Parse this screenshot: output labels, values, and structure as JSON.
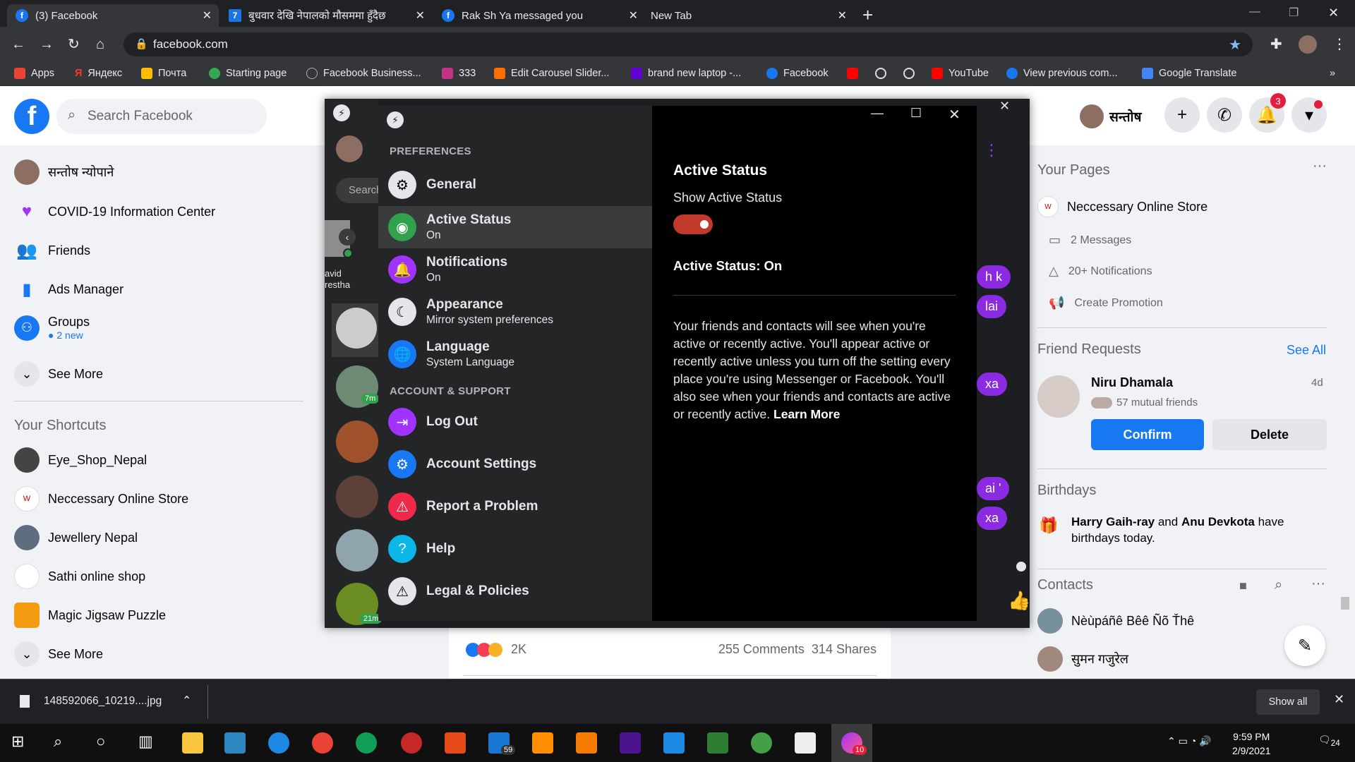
{
  "browser": {
    "tabs": [
      {
        "title": "(3) Facebook",
        "active": true
      },
      {
        "title": "बुधवार देखि नेपालको मौसममा हुँदैछ",
        "active": false
      },
      {
        "title": "Rak Sh Ya messaged you",
        "active": false
      },
      {
        "title": "New Tab",
        "active": false
      }
    ],
    "url": "facebook.com",
    "bookmarks": [
      "Apps",
      "Яндекс",
      "Почта",
      "Starting page",
      "Facebook Business...",
      "333",
      "Edit Carousel Slider...",
      "brand new laptop -...",
      "Facebook",
      "YouTube",
      "View previous com...",
      "Google Translate"
    ]
  },
  "fb": {
    "search_placeholder": "Search Facebook",
    "profile_name": "सन्तोष",
    "notif_count": "3",
    "left_items": [
      {
        "label": "सन्तोष न्योपाने"
      },
      {
        "label": "COVID-19 Information Center"
      },
      {
        "label": "Friends"
      },
      {
        "label": "Ads Manager"
      },
      {
        "label": "Groups",
        "sub": "2 new"
      },
      {
        "label": "See More"
      }
    ],
    "shortcuts_title": "Your Shortcuts",
    "shortcuts": [
      "Eye_Shop_Nepal",
      "Neccessary Online Store",
      "Jewellery Nepal",
      "Sathi online shop",
      "Magic Jigsaw Puzzle",
      "See More"
    ],
    "right": {
      "your_pages_title": "Your Pages",
      "page_name": "Neccessary Online Store",
      "page_links": [
        "2 Messages",
        "20+ Notifications",
        "Create Promotion"
      ],
      "friend_requests_title": "Friend Requests",
      "see_all": "See All",
      "request_name": "Niru Dhamala",
      "request_age": "4d",
      "mutual": "57 mutual friends",
      "confirm": "Confirm",
      "delete": "Delete",
      "birthdays_title": "Birthdays",
      "birthday_a": "Harry Gaih-ray",
      "birthday_and": " and ",
      "birthday_b": "Anu Devkota",
      "birthday_rest": " have birthdays today.",
      "contacts_title": "Contacts",
      "contacts": [
        "Nèùpáñê Bêê Ñõ Ťhê",
        "सुमन गजुरेल"
      ]
    },
    "post_stats": {
      "reactions": "2K",
      "comments": "255 Comments",
      "shares": "314 Shares"
    }
  },
  "messenger": {
    "search_placeholder": "Search",
    "contact_names": [
      "avid",
      "restha"
    ],
    "badges": [
      "7m",
      "21m"
    ],
    "bubbles": [
      "h k",
      "lai",
      "xa",
      "ai '",
      "xa"
    ],
    "preferences_header": "PREFERENCES",
    "preferences": [
      {
        "title": "General",
        "sub": ""
      },
      {
        "title": "Active Status",
        "sub": "On"
      },
      {
        "title": "Notifications",
        "sub": "On"
      },
      {
        "title": "Appearance",
        "sub": "Mirror system preferences"
      },
      {
        "title": "Language",
        "sub": "System Language"
      }
    ],
    "account_header": "ACCOUNT & SUPPORT",
    "account": [
      "Log Out",
      "Account Settings",
      "Report a Problem",
      "Help",
      "Legal & Policies"
    ],
    "detail": {
      "title": "Active Status",
      "toggle_label": "Show Active Status",
      "toggle_on": true,
      "status_line": "Active Status: On",
      "description": "Your friends and contacts will see when you're active or recently active. You'll appear active or recently active unless you turn off the setting every place you're using Messenger or Facebook. You'll also see when your friends and contacts are active or recently active.",
      "learn_more": "Learn More"
    },
    "accent_color": "#e1306c"
  },
  "downloads": {
    "file": "148592066_10219....jpg",
    "show_all": "Show all"
  },
  "taskbar": {
    "time": "9:59 PM",
    "date": "2/9/2021",
    "mail_badge": "59",
    "messenger_badge": "10",
    "notif_count": "24"
  }
}
